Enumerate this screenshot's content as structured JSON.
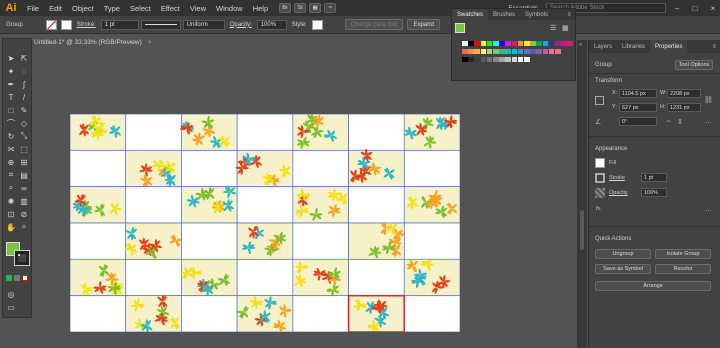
{
  "app": {
    "logo": "Ai"
  },
  "menu": [
    "File",
    "Edit",
    "Object",
    "Type",
    "Select",
    "Effect",
    "View",
    "Window",
    "Help"
  ],
  "menubar_right": {
    "workspace": "Essentials",
    "search_placeholder": "Search Adobe Stock"
  },
  "control": {
    "selection_label": "Group",
    "stroke_label": "Stroke:",
    "stroke_value": "1 pt",
    "profile": "Uniform",
    "opacity_label": "Opacity:",
    "opacity_value": "100%",
    "style_label": "Style:",
    "change_text": "Change case fold",
    "expand": "Expand"
  },
  "document": {
    "tab_title": "Untitled-1* @ 33.33% (RGB/Preview)"
  },
  "swatches": {
    "tabs": [
      "Swatches",
      "Brushes",
      "Symbols"
    ],
    "colors": [
      "#ffffff",
      "#000000",
      "#ff0000",
      "#ffff00",
      "#00ff00",
      "#00ffff",
      "#0000ff",
      "#ff00ff",
      "#ed1c24",
      "#f7941d",
      "#fff200",
      "#8dc63f",
      "#00a651",
      "#00aeef",
      "#2e3192",
      "#92278f",
      "#ec008c",
      "#ed145b",
      "#f26c4f",
      "#f68e56",
      "#fbaf5d",
      "#fff568",
      "#acd373",
      "#7cc576",
      "#3cb878",
      "#1abbb4",
      "#00bff3",
      "#438ccb",
      "#5574b9",
      "#605ca8",
      "#8560a8",
      "#a864a8",
      "#f06ea9",
      "#f26d7d",
      "#000000",
      "#262626",
      "#404040",
      "#595959",
      "#737373",
      "#8c8c8c",
      "#a6a6a6",
      "#bfbfbf",
      "#d9d9d9",
      "#f2f2f2",
      "#ffffff"
    ]
  },
  "properties": {
    "tabs": [
      "Layers",
      "Libraries",
      "Properties"
    ],
    "group_label": "Group",
    "tool_options": "Tool Options",
    "transform_title": "Transform",
    "x_label": "X:",
    "x_value": "1104.5 px",
    "y_label": "Y:",
    "y_value": "627 px",
    "w_label": "W:",
    "w_value": "2208 px",
    "h_label": "H:",
    "h_value": "1231 px",
    "angle_value": "0°",
    "appearance_title": "Appearance",
    "fill_label": "Fill",
    "stroke_label": "Stroke",
    "stroke_value": "1 pt",
    "opacity_label": "Opacity",
    "opacity_value": "100%",
    "fx_label": "fx.",
    "quick_actions_title": "Quick Actions",
    "ungroup": "Ungroup",
    "isolate_group": "Isolate Group",
    "save_as_symbol": "Save as Symbol",
    "recolor": "Recolor",
    "arrange": "Arrange"
  },
  "artboard": {
    "rows": 6,
    "cols": 7,
    "pattern_colors": [
      "#f2e21a",
      "#2fb6c9",
      "#e2421c",
      "#7cbf2e",
      "#f5a21e"
    ]
  }
}
